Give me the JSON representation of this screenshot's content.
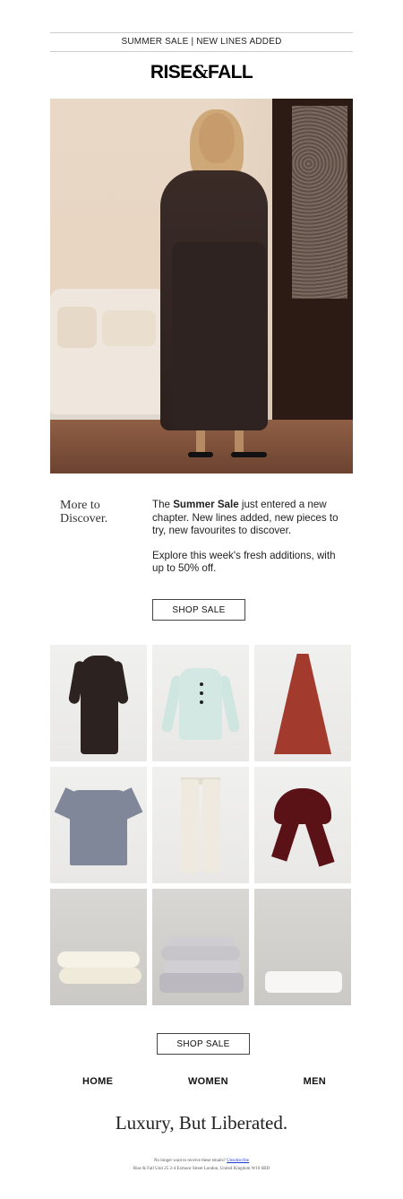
{
  "header": {
    "announcement": "SUMMER SALE | NEW LINES ADDED",
    "brand": {
      "part1": "RISE",
      "amp": "&",
      "part2": "FALL"
    }
  },
  "intro": {
    "lead_line1": "More to",
    "lead_line2": "Discover.",
    "p1_before": "The ",
    "p1_bold": "Summer Sale",
    "p1_after": " just entered a new chapter. New lines added, new pieces to try, new favourites to discover.",
    "p2": "Explore this week's fresh additions, with up to 50% off."
  },
  "cta": {
    "shop_sale_top": "SHOP SALE",
    "shop_sale_bottom": "SHOP SALE"
  },
  "products": [
    {
      "icon": "dark-dress-icon"
    },
    {
      "icon": "light-blouse-icon"
    },
    {
      "icon": "red-dress-icon"
    },
    {
      "icon": "grey-tshirt-icon"
    },
    {
      "icon": "cream-trousers-icon"
    },
    {
      "icon": "burgundy-scarf-icon"
    },
    {
      "icon": "pillowcases-icon"
    },
    {
      "icon": "folded-sheets-icon"
    },
    {
      "icon": "folded-linen-icon"
    }
  ],
  "nav": {
    "home": "HOME",
    "women": "WOMEN",
    "men": "MEN"
  },
  "footer": {
    "tagline": "Luxury, But Liberated.",
    "unsubscribe_prompt": "No longer want to receive these emails?",
    "unsubscribe_link": "Unsubscribe",
    "address": "Rise & Fall Unit 25 2-4 Exmoor Street London, United Kingdom W10 6BD"
  },
  "colors": {
    "accent_dark": "#2c2320",
    "link": "#1c3cd3",
    "border": "#cfcfcf"
  }
}
